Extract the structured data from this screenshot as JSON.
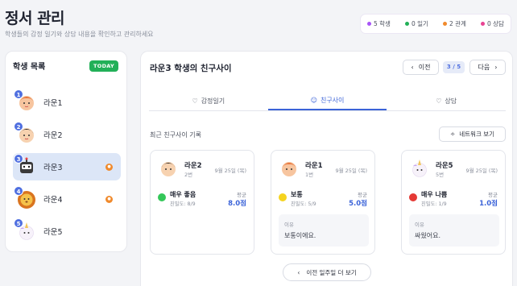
{
  "header": {
    "title": "정서 관리",
    "subtitle": "학생들의 감정 일기와 상담 내용을 확인하고 관리하세요"
  },
  "stats": [
    {
      "label": "5 학생",
      "color": "#a855f7"
    },
    {
      "label": "0 일기",
      "color": "#22b058"
    },
    {
      "label": "2 관계",
      "color": "#f08a2c"
    },
    {
      "label": "0 상담",
      "color": "#e84393"
    }
  ],
  "sidebar": {
    "title": "학생 목록",
    "today_badge": "TODAY",
    "students": [
      {
        "num": "1",
        "name": "라운1",
        "icon": "avatar-orange-hair",
        "selected": false,
        "badge": false
      },
      {
        "num": "2",
        "name": "라운2",
        "icon": "avatar-black-hair",
        "selected": false,
        "badge": false
      },
      {
        "num": "3",
        "name": "라운3",
        "icon": "avatar-robot",
        "selected": true,
        "badge": true
      },
      {
        "num": "4",
        "name": "라운4",
        "icon": "avatar-lion",
        "selected": false,
        "badge": true
      },
      {
        "num": "5",
        "name": "라운5",
        "icon": "avatar-unicorn",
        "selected": false,
        "badge": false
      }
    ]
  },
  "main": {
    "title": "라운3 학생의 친구사이",
    "prev_label": "이전",
    "next_label": "다음",
    "pager": "3 / 5",
    "tabs": [
      {
        "label": "감정일기",
        "icon": "heart-icon",
        "active": false
      },
      {
        "label": "친구사이",
        "icon": "users-icon",
        "active": true
      },
      {
        "label": "상담",
        "icon": "heart-icon",
        "active": false
      }
    ],
    "section_label": "최근 친구사이 기록",
    "network_button": "네트워크 보기",
    "more_button": "이전 일주일 더 보기",
    "cards": [
      {
        "name": "라운2",
        "class": "2번",
        "date": "9월 25일 (목)",
        "mood": "매우 좋음",
        "mood_color": "#34c759",
        "closeness": "친밀도: 8/9",
        "avg_label": "평균",
        "avg": "8.0점",
        "reason_label": "",
        "reason": ""
      },
      {
        "name": "라운1",
        "class": "1번",
        "date": "9월 25일 (목)",
        "mood": "보통",
        "mood_color": "#f5d31f",
        "closeness": "친밀도: 5/9",
        "avg_label": "평균",
        "avg": "5.0점",
        "reason_label": "이유",
        "reason": "보통이에요."
      },
      {
        "name": "라운5",
        "class": "5번",
        "date": "9월 25일 (목)",
        "mood": "매우 나쁨",
        "mood_color": "#e53935",
        "closeness": "친밀도: 1/9",
        "avg_label": "평균",
        "avg": "1.0점",
        "reason_label": "이유",
        "reason": "싸웠어요."
      }
    ]
  }
}
